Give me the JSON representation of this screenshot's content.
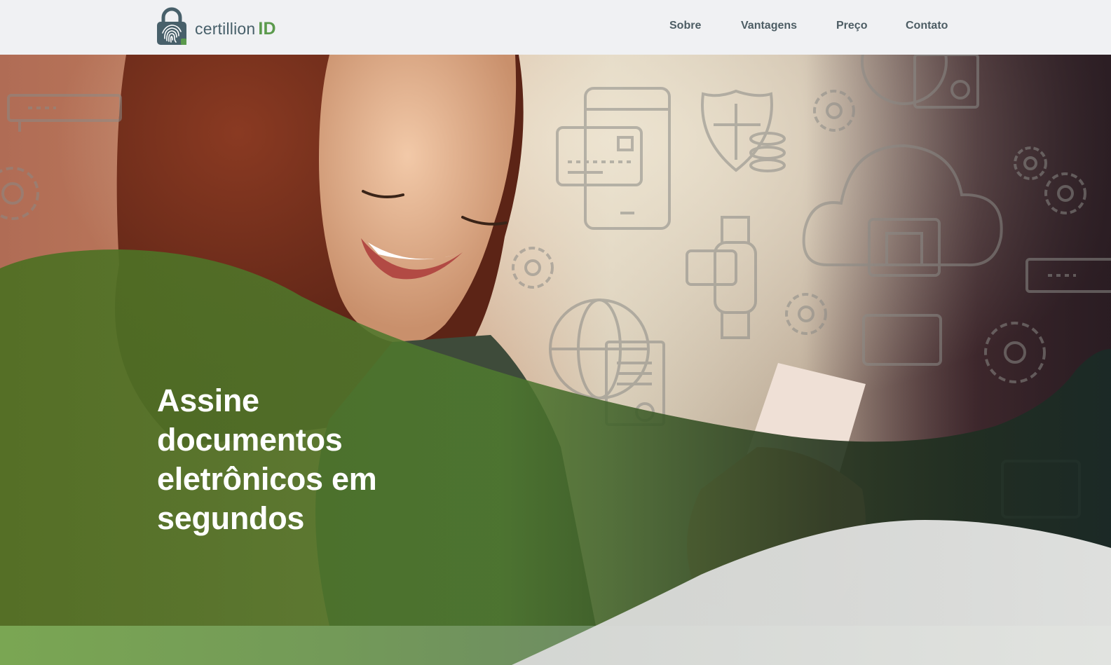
{
  "header": {
    "brand": {
      "name": "certillion",
      "suffix": "ID",
      "icon": "fingerprint-lock-icon"
    },
    "nav": [
      {
        "label": "Sobre"
      },
      {
        "label": "Vantagens"
      },
      {
        "label": "Preço"
      },
      {
        "label": "Contato"
      }
    ]
  },
  "hero": {
    "title": "Assine documentos eletrônicos em segundos",
    "background_icons": [
      "credit-card-icon",
      "tablet-icon",
      "shield-coins-icon",
      "gear-icon",
      "cloud-icon",
      "chip-icon",
      "smartwatch-icon",
      "globe-icon",
      "certificate-icon",
      "server-icon"
    ]
  },
  "colors": {
    "brand_green": "#5b9a4c",
    "brand_slate": "#48606a",
    "nav_text": "#4d5d64",
    "header_bg": "#f0f1f3",
    "hero_overlay_green": "#4f7a2f",
    "band_green": "#7aa653"
  }
}
